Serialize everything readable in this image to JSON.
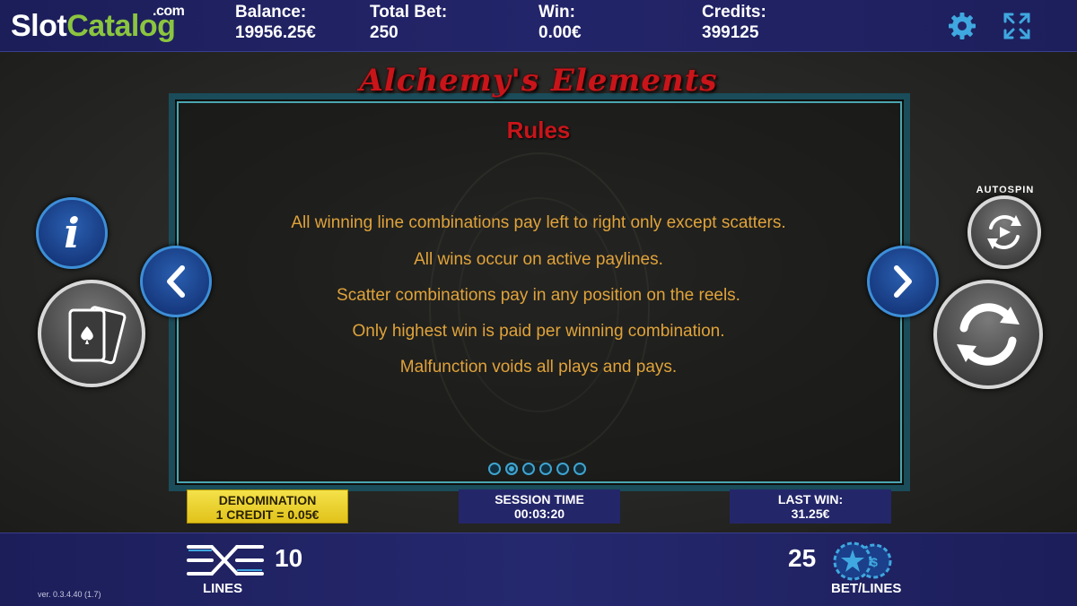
{
  "logo": {
    "slot": "Slot",
    "catalog": "Catalog",
    "com": ".com"
  },
  "topbar": {
    "balance_label": "Balance:",
    "balance_value": "19956.25€",
    "total_bet_label": "Total Bet:",
    "total_bet_value": "250",
    "win_label": "Win:",
    "win_value": "0.00€",
    "credits_label": "Credits:",
    "credits_value": "399125"
  },
  "icons": {
    "settings": "gear-icon",
    "fullscreen": "expand-icon",
    "info": "info-icon",
    "prev": "chevron-left-icon",
    "next": "chevron-right-icon",
    "paytable": "playing-cards-icon",
    "spin": "spin-arrows-icon",
    "autospin": "autospin-icon",
    "lines": "lines-icon",
    "chips": "chips-icon"
  },
  "game": {
    "title": "Alchemy's Elements"
  },
  "rules": {
    "title": "Rules",
    "lines": [
      "All winning line combinations pay left to right only except scatters.",
      "All wins occur on active paylines.",
      "Scatter combinations pay in any position on the reels.",
      "Only highest win is paid per winning combination.",
      "Malfunction voids all plays and pays."
    ],
    "page_count": 6,
    "active_page": 2
  },
  "autospin": {
    "label": "AUTOSPIN"
  },
  "info_boxes": {
    "denomination_label": "DENOMINATION",
    "denomination_value": "1 CREDIT = 0.05€",
    "session_label": "SESSION TIME",
    "session_value": "00:03:20",
    "last_win_label": "LAST WIN:",
    "last_win_value": "31.25€"
  },
  "bottom": {
    "lines_value": "10",
    "lines_label": "LINES",
    "bet_value": "25",
    "bet_label": "BET/LINES",
    "version": "ver. 0.3.4.40 (1.7)"
  },
  "colors": {
    "accent_blue": "#3d8fd8",
    "title_red": "#c8151a",
    "rule_text": "#e0a33a",
    "denom_yellow": "#f4e24a"
  }
}
